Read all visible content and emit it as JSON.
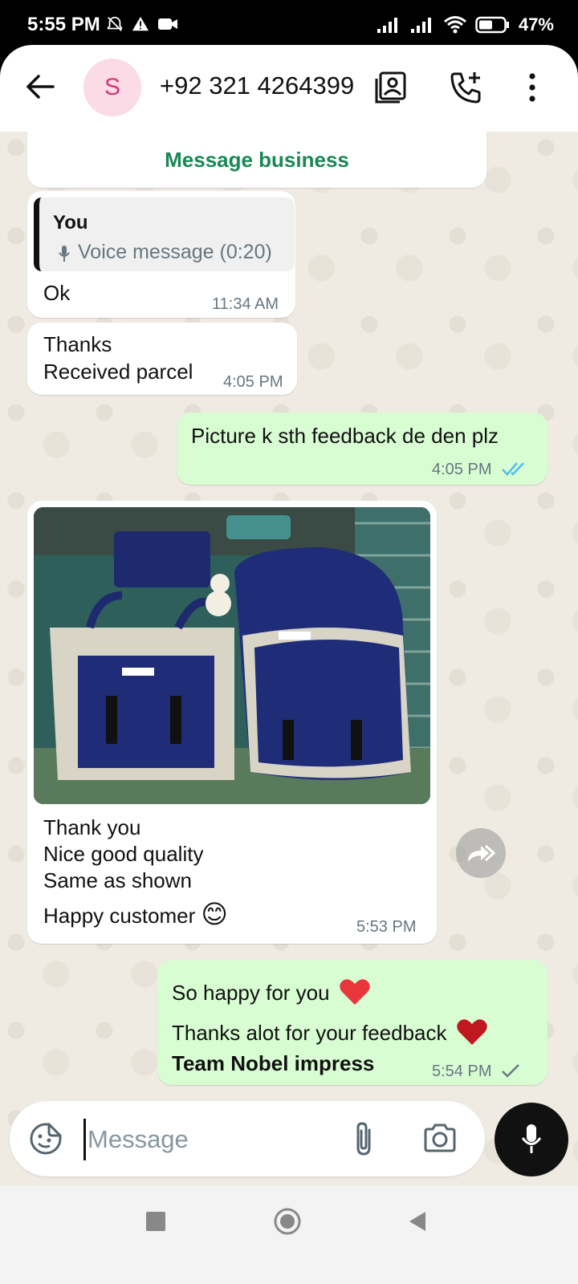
{
  "status": {
    "time": "5:55 PM",
    "battery": "47%"
  },
  "header": {
    "avatar_letter": "S",
    "contact": "+92 321 4264399"
  },
  "chat": {
    "business_button": "Message business",
    "messages": [
      {
        "quote_author": "You",
        "quote_text": "Voice message (0:20)",
        "text": "Ok",
        "time": "11:34 AM"
      },
      {
        "text_line1": "Thanks",
        "text_line2": "Received parcel",
        "time": "4:05 PM"
      },
      {
        "text": "Picture k sth feedback de den plz",
        "time": "4:05 PM"
      },
      {
        "line1": "Thank you",
        "line2": "Nice good quality",
        "line3": "Same as shown",
        "line4": "Happy customer",
        "emoji": "😊",
        "time": "5:53 PM"
      },
      {
        "line1": "So happy for you",
        "line2": "Thanks alot for your feedback",
        "line3": "Team Nobel impress",
        "time": "5:54 PM"
      }
    ]
  },
  "composer": {
    "placeholder": "Message"
  },
  "colors": {
    "accent_green": "#1b8755",
    "outgoing_bubble": "#d9fdd3",
    "read_tick": "#53bdeb",
    "avatar_bg": "#fadbe6",
    "avatar_fg": "#d13b77"
  }
}
